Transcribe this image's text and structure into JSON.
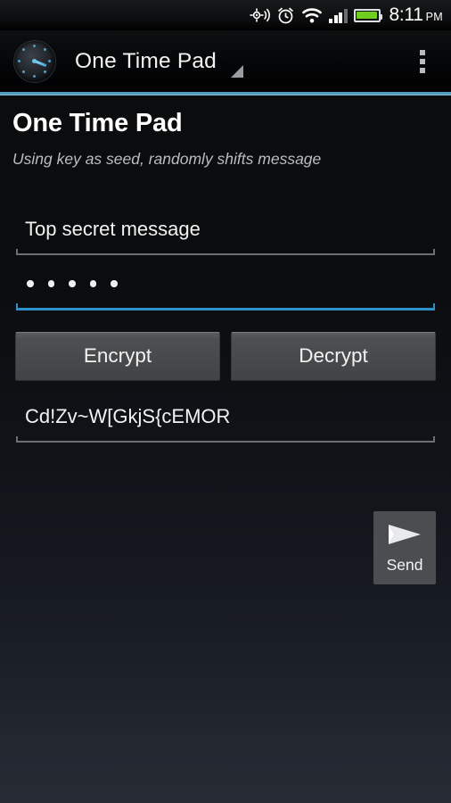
{
  "statusbar": {
    "icons": [
      "gps-icon",
      "alarm-icon",
      "wifi-icon",
      "signal-icon",
      "battery-icon"
    ],
    "time": "8:11",
    "ampm": "PM",
    "battery_color": "#6fcf1f"
  },
  "actionbar": {
    "app_icon": "compass-gauge-icon",
    "title": "One Time Pad",
    "spinner_indicator": "dropdown-triangle-icon",
    "overflow": "overflow-menu-icon",
    "accent_color": "#4f9cbf"
  },
  "page": {
    "title": "One Time Pad",
    "subtitle": "Using key as seed, randomly shifts message"
  },
  "message_field": {
    "name": "message-input",
    "value": "Top secret message",
    "placeholder": "Message",
    "focused": false
  },
  "key_field": {
    "name": "key-input",
    "masked_value": "• • • • •",
    "char_count": 5,
    "placeholder": "Key",
    "focused": true,
    "focus_color": "#2f91c9"
  },
  "buttons": {
    "encrypt_label": "Encrypt",
    "decrypt_label": "Decrypt"
  },
  "output_field": {
    "name": "output-text",
    "value": "Cd!Zv~W[GkjS{cEMOR",
    "focused": false
  },
  "send_button": {
    "icon": "send-paper-plane-icon",
    "label": "Send"
  }
}
